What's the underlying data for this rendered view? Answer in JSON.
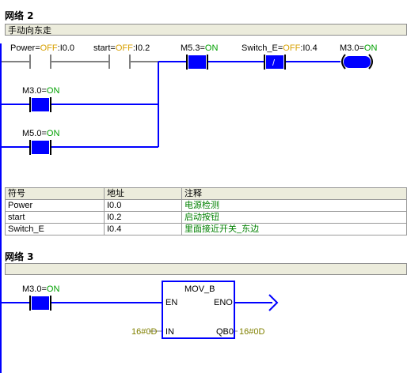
{
  "network2": {
    "title": "网络 2",
    "comment": "手动向东走",
    "contacts": [
      {
        "name": "Power",
        "state": "OFF",
        "addr": "I0.0"
      },
      {
        "name": "start",
        "state": "OFF",
        "addr": "I0.2"
      },
      {
        "name": "M5.3",
        "state": "ON",
        "addr": ""
      },
      {
        "name": "Switch_E",
        "state": "OFF",
        "addr": "I0.4"
      },
      {
        "name": "M3.0",
        "state": "ON",
        "addr": ""
      },
      {
        "name": "M5.0",
        "state": "ON",
        "addr": ""
      }
    ],
    "coil": {
      "name": "M3.0",
      "state": "ON"
    },
    "not_symbol": "/"
  },
  "symbol_table": {
    "headers": [
      "符号",
      "地址",
      "注释"
    ],
    "rows": [
      {
        "symbol": "Power",
        "address": "I0.0",
        "comment": "电源检测"
      },
      {
        "symbol": "start",
        "address": "I0.2",
        "comment": "启动按钮"
      },
      {
        "symbol": "Switch_E",
        "address": "I0.4",
        "comment": "里面接近开关_东边"
      }
    ]
  },
  "network3": {
    "title": "网络 3",
    "comment": "",
    "contact": {
      "name": "M3.0",
      "state": "ON"
    },
    "block": {
      "name": "MOV_B",
      "en": "EN",
      "eno": "ENO",
      "in": "IN",
      "out": "QB0",
      "in_value": "16#0D",
      "out_value": "16#0D"
    }
  },
  "colors": {
    "on": "#00a000",
    "off": "#00a000",
    "wire": "#0000ff",
    "energized": "#0000ff",
    "comment_text": "#008000"
  }
}
